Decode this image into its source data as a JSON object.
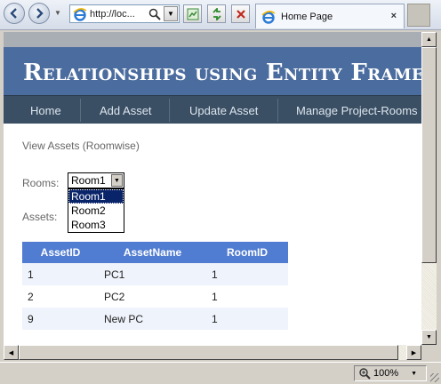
{
  "browser": {
    "address_url": "http://loc...",
    "tab_title": "Home Page",
    "tab_close": "×",
    "zoom_level": "100%"
  },
  "page": {
    "site_title": "Relationships using Entity Framework",
    "menu": [
      "Home",
      "Add Asset",
      "Update Asset",
      "Manage Project-Rooms"
    ],
    "subtitle": "View Assets (Roomwise)",
    "rooms_label": "Rooms:",
    "assets_label": "Assets:",
    "room_select": {
      "value": "Room1",
      "options": [
        "Room1",
        "Room2",
        "Room3"
      ],
      "highlighted": "Room1"
    },
    "table": {
      "headers": [
        "AssetID",
        "AssetName",
        "RoomID"
      ],
      "rows": [
        [
          "1",
          "PC1",
          "1"
        ],
        [
          "2",
          "PC2",
          "1"
        ],
        [
          "9",
          "New PC",
          "1"
        ]
      ]
    }
  },
  "colors": {
    "header_bg": "#4b6c9e",
    "menu_bg": "#3a4f63",
    "table_header_bg": "#507cd1",
    "row_alt_bg": "#eff3fb",
    "selection_bg": "#0a246a"
  }
}
